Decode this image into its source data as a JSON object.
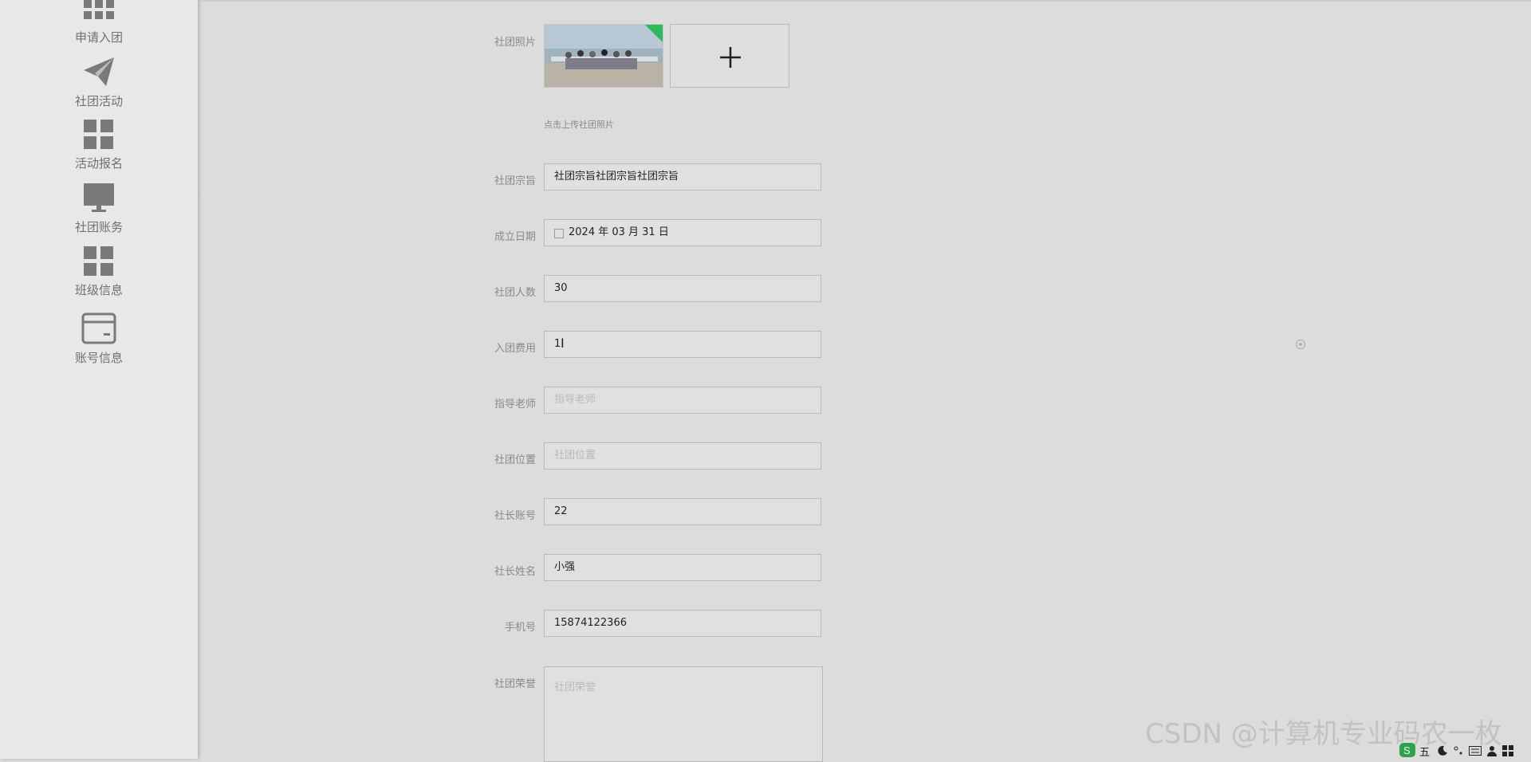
{
  "sidebar": {
    "items": [
      {
        "label": "申请入团",
        "icon": "grid-icon"
      },
      {
        "label": "社团活动",
        "icon": "paper-plane-icon"
      },
      {
        "label": "活动报名",
        "icon": "grid-icon"
      },
      {
        "label": "社团账务",
        "icon": "monitor-icon"
      },
      {
        "label": "班级信息",
        "icon": "grid-icon"
      },
      {
        "label": "账号信息",
        "icon": "card-icon"
      }
    ]
  },
  "form": {
    "photo": {
      "label": "社团照片",
      "hint": "点击上传社团照片",
      "upload_icon": "plus-icon"
    },
    "purpose": {
      "label": "社团宗旨",
      "value": "社团宗旨社团宗旨社团宗旨"
    },
    "founded": {
      "label": "成立日期",
      "value": "2024 年 03 月 31 日"
    },
    "members": {
      "label": "社团人数",
      "value": "30"
    },
    "fee": {
      "label": "入团费用",
      "value": "1"
    },
    "advisor": {
      "label": "指导老师",
      "placeholder": "指导老师"
    },
    "location": {
      "label": "社团位置",
      "placeholder": "社团位置"
    },
    "leader_account": {
      "label": "社长账号",
      "value": "22"
    },
    "leader_name": {
      "label": "社长姓名",
      "value": "小强"
    },
    "phone": {
      "label": "手机号",
      "value": "15874122366"
    },
    "honors": {
      "label": "社团荣誉",
      "placeholder": "社团荣誉"
    }
  },
  "watermark": "CSDN @计算机专业码农一枚",
  "taskbar": {
    "ime": "五"
  }
}
